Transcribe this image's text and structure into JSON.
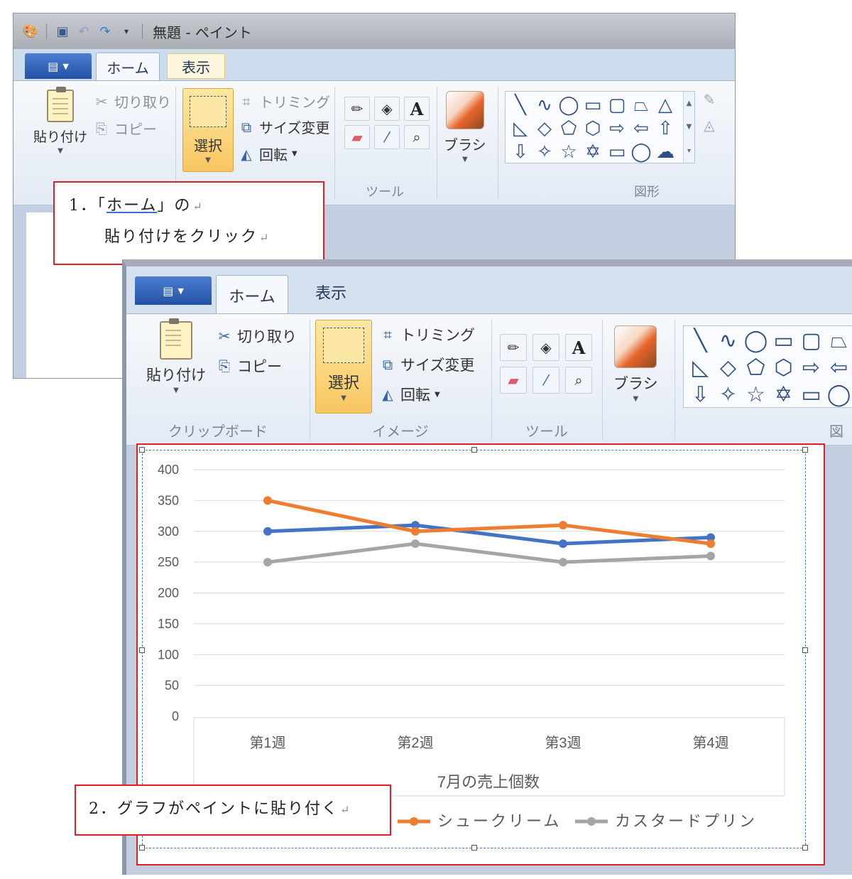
{
  "colors": {
    "callout_border": "#e31e24",
    "series_blue": "#4472c4",
    "series_orange": "#ed7d31",
    "series_gray": "#a5a5a5"
  },
  "window_back": {
    "title": "無題 - ペイント",
    "qat_icons": [
      "paint-app-icon",
      "save-icon",
      "undo-icon",
      "redo-icon",
      "dropdown-icon"
    ],
    "tabs": [
      "ホーム",
      "表示"
    ],
    "clipboard": {
      "paste": "貼り付け",
      "cut": "切り取り",
      "copy": "コピー"
    },
    "image": {
      "select": "選択",
      "crop": "トリミング",
      "resize": "サイズ変更",
      "rotate": "回転"
    },
    "tools_label": "ツール",
    "brush": "ブラシ",
    "shapes_label": "図形"
  },
  "window_front": {
    "tabs": [
      "ホーム",
      "表示"
    ],
    "clipboard": {
      "paste": "貼り付け",
      "cut": "切り取り",
      "copy": "コピー",
      "label": "クリップボード"
    },
    "image": {
      "select": "選択",
      "crop": "トリミング",
      "resize": "サイズ変更",
      "rotate": "回転",
      "label": "イメージ"
    },
    "tools_label": "ツール",
    "brush": "ブラシ",
    "shapes_label_partial": "図"
  },
  "callout1": {
    "num": "1．",
    "open": "「",
    "home": "ホーム",
    "close": "」の",
    "line2": "貼り付けをクリック"
  },
  "callout2": {
    "text": "2．グラフがペイントに貼り付く"
  },
  "chart_data": {
    "type": "line",
    "categories": [
      "第1週",
      "第2週",
      "第3週",
      "第4週"
    ],
    "series": [
      {
        "name": "",
        "values": [
          300,
          310,
          280,
          290
        ]
      },
      {
        "name": "シュークリーム",
        "values": [
          350,
          300,
          310,
          280
        ]
      },
      {
        "name": "カスタードプリン",
        "values": [
          250,
          280,
          250,
          260
        ]
      }
    ],
    "xlabel": "7月の売上個数",
    "ylim": [
      0,
      400
    ],
    "yticks": [
      "400",
      "350",
      "300",
      "250",
      "200",
      "150",
      "100",
      "50",
      "0"
    ],
    "grid": true,
    "legend": "bottom"
  }
}
